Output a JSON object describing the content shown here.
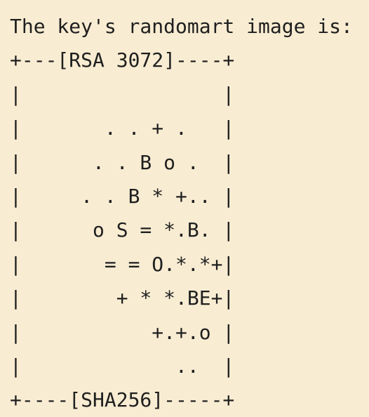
{
  "terminal": {
    "header_text": "The key's randomart image is:",
    "lines": [
      "+---[RSA 3072]----+",
      "|                 |",
      "|       . . + .   |",
      "|      . . B o .  |",
      "|     . . B * +.. |",
      "|      o S = *.B. |",
      "|       = = O.*.*+|",
      "|        + * *.BE+|",
      "|           +.+.o |",
      "|             ..  |",
      "+----[SHA256]-----+"
    ]
  }
}
